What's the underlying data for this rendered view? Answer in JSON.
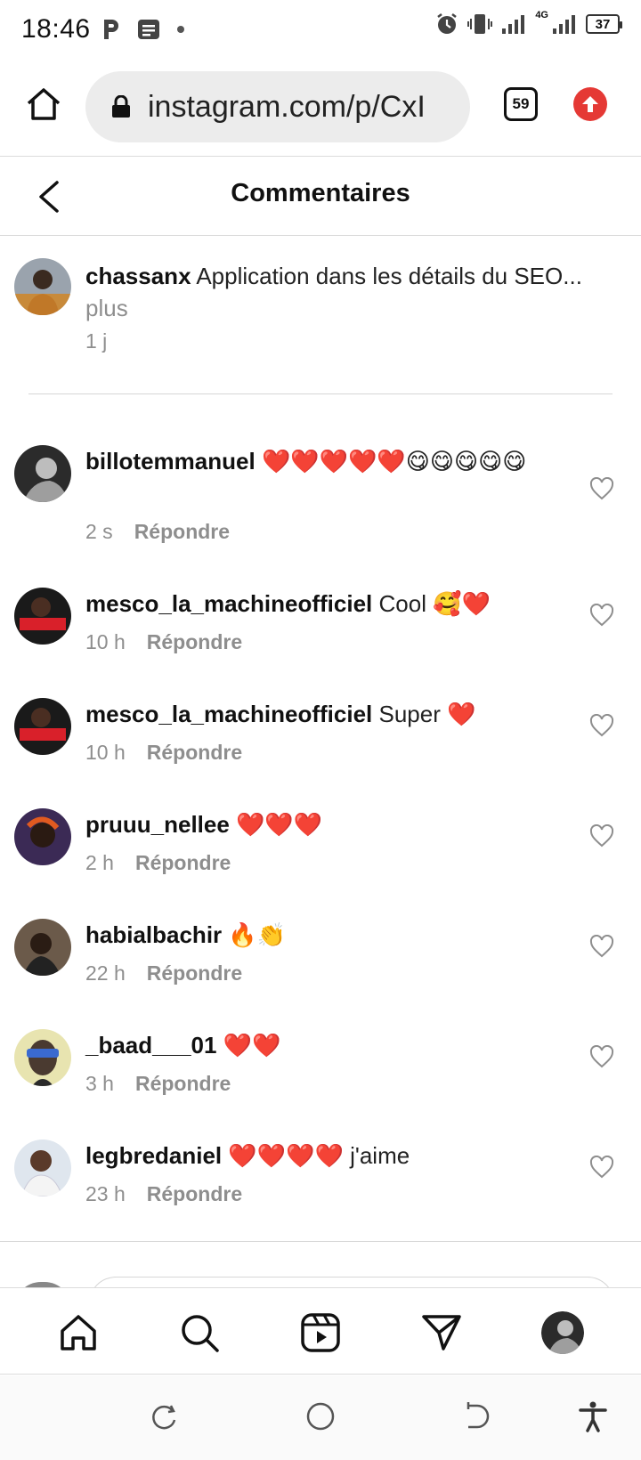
{
  "status_bar": {
    "time": "18:46",
    "network": "4G",
    "battery": "37"
  },
  "browser": {
    "url": "instagram.com/p/CxI",
    "tab_count": "59"
  },
  "header": {
    "title": "Commentaires"
  },
  "caption": {
    "username": "chassanx",
    "text": "Application dans les détails du SEO...",
    "more": "plus",
    "time": "1 j"
  },
  "comments": [
    {
      "username": "billotemmanuel",
      "text": "❤️❤️❤️❤️❤️😋😋😋😋😋",
      "time": "2 s",
      "reply": "Répondre"
    },
    {
      "username": "mesco_la_machineofficiel",
      "text": "Cool 🥰❤️",
      "time": "10 h",
      "reply": "Répondre"
    },
    {
      "username": "mesco_la_machineofficiel",
      "text": "Super ❤️",
      "time": "10 h",
      "reply": "Répondre"
    },
    {
      "username": "pruuu_nellee",
      "text": "❤️❤️❤️",
      "time": "2 h",
      "reply": "Répondre"
    },
    {
      "username": "habialbachir",
      "text": "🔥👏",
      "time": "22 h",
      "reply": "Répondre"
    },
    {
      "username": "_baad___01",
      "text": "❤️❤️",
      "time": "3 h",
      "reply": "Répondre"
    },
    {
      "username": "legbredaniel",
      "text": "❤️❤️❤️❤️ j'aime",
      "time": "23 h",
      "reply": "Répondre"
    }
  ],
  "colors": {
    "accent_red": "#e53935",
    "muted_text": "#8e8e8e"
  },
  "icons": {
    "tab_bar": [
      "home-icon",
      "search-icon",
      "reels-icon",
      "direct-message-icon",
      "profile-avatar"
    ],
    "system_nav": [
      "recent-apps-icon",
      "home-circle-icon",
      "back-icon",
      "accessibility-icon"
    ]
  }
}
